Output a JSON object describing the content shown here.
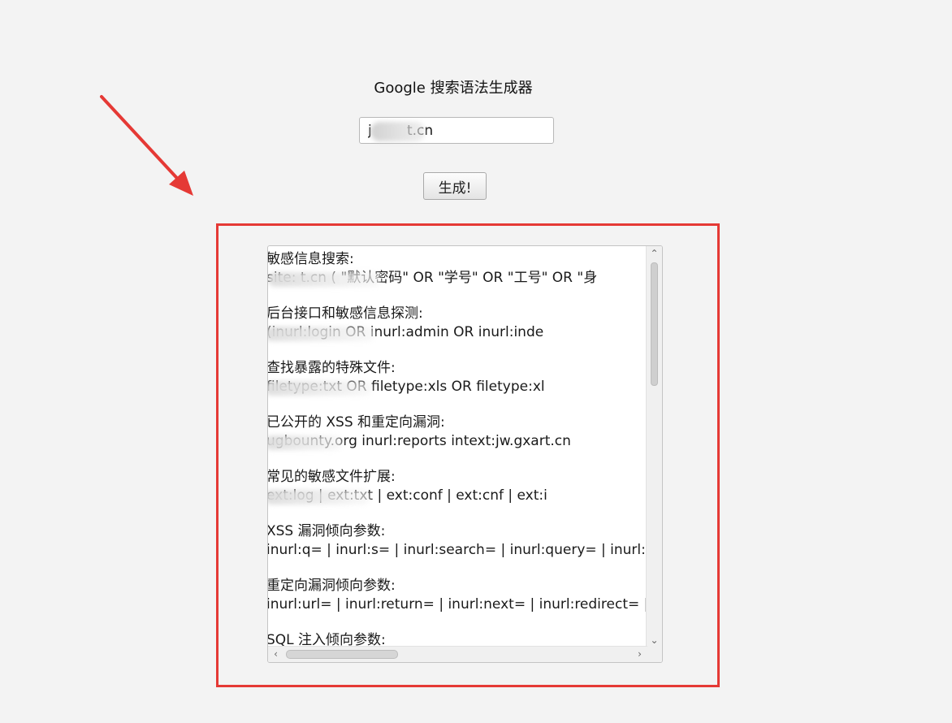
{
  "app": {
    "title": "Google 搜索语法生成器",
    "domain_input_value": "j        t.cn",
    "generate_label": "生成!"
  },
  "results": [
    {
      "heading": "敏感信息搜索:",
      "query": "site:           t.cn ( \"默认密码\" OR \"学号\" OR \"工号\" OR \"身"
    },
    {
      "heading": "后台接口和敏感信息探测:",
      "query": "                     (inurl:login OR inurl:admin OR inurl:inde"
    },
    {
      "heading": "查找暴露的特殊文件:",
      "query": "                     filetype:txt OR filetype:xls OR filetype:xl"
    },
    {
      "heading": "已公开的 XSS 和重定向漏洞:",
      "query": "                     ugbounty.org inurl:reports intext:jw.gxart.cn"
    },
    {
      "heading": "常见的敏感文件扩展:",
      "query": "                     ext:log | ext:txt | ext:conf | ext:cnf | ext:i"
    },
    {
      "heading": "XSS 漏洞倾向参数:",
      "query": "inurl:q= | inurl:s= | inurl:search= | inurl:query= | inurl:k"
    },
    {
      "heading": "重定向漏洞倾向参数:",
      "query": "inurl:url= | inurl:return= | inurl:next= | inurl:redirect= | i"
    },
    {
      "heading": "SQL 注入倾向参数:",
      "query": ""
    }
  ],
  "scrollbar": {
    "up": "⌃",
    "down": "⌄",
    "left": "‹",
    "right": "›"
  },
  "colors": {
    "highlight": "#e53935",
    "arrow": "#e53935"
  }
}
